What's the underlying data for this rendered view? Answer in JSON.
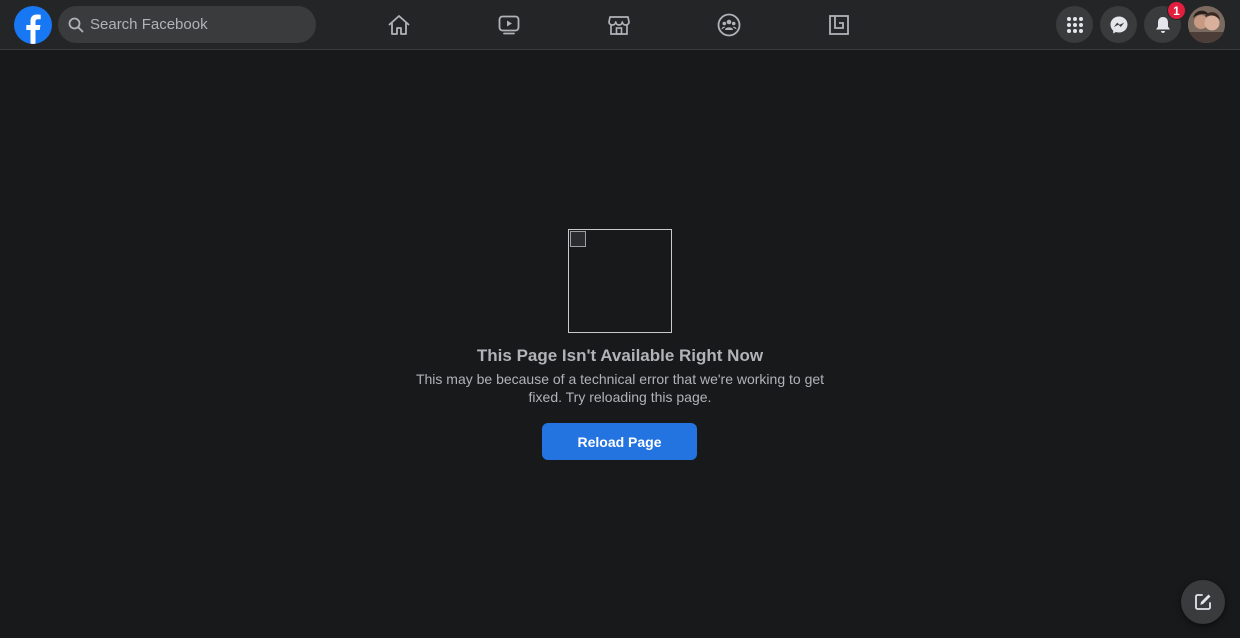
{
  "header": {
    "search": {
      "placeholder": "Search Facebook"
    },
    "nav_tabs": [
      {
        "icon": "home-icon"
      },
      {
        "icon": "watch-icon"
      },
      {
        "icon": "marketplace-icon"
      },
      {
        "icon": "groups-icon"
      },
      {
        "icon": "gaming-icon"
      }
    ],
    "notifications": {
      "count": "1"
    }
  },
  "error": {
    "title": "This Page Isn't Available Right Now",
    "message": "This may be because of a technical error that we're working to get fixed. Try reloading this page.",
    "reload_label": "Reload Page"
  },
  "colors": {
    "background": "#18191a",
    "topbar": "#242526",
    "brand_blue": "#1877f2",
    "button_blue": "#2374e1",
    "badge_red": "#e41e3f"
  }
}
